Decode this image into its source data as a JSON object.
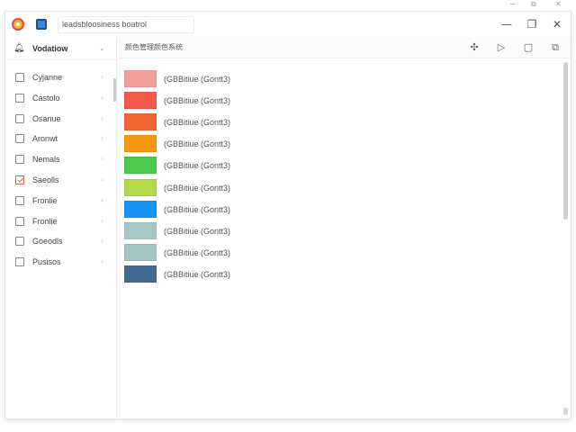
{
  "desktop": {
    "minimize": "−",
    "restore": "⧉",
    "close": "✕"
  },
  "titlebar": {
    "field_text": "leadsbloosiness boatrol",
    "minimize": "—",
    "maximize": "❐",
    "close": "✕"
  },
  "sidebar": {
    "header_label": "Vodatiow",
    "items": [
      {
        "label": "Cyjanne",
        "checked": false
      },
      {
        "label": "Castolo",
        "checked": false
      },
      {
        "label": "Osanue",
        "checked": false
      },
      {
        "label": "Aronwt",
        "checked": false
      },
      {
        "label": "Nemals",
        "checked": false
      },
      {
        "label": "Saeolls",
        "checked": true
      },
      {
        "label": "Fronlie",
        "checked": false
      },
      {
        "label": "Fronlie",
        "checked": false
      },
      {
        "label": "Goeodls",
        "checked": false
      },
      {
        "label": "Pusisos",
        "checked": false
      }
    ]
  },
  "main": {
    "title": "颜色管理颜色系统",
    "rows": [
      {
        "label": "(GBBitiue (Gontt3)",
        "color": "#f4a09a"
      },
      {
        "label": "(GBBitiue (Gontt3)",
        "color": "#f45a4c"
      },
      {
        "label": "(GBBitiue (Gontt3)",
        "color": "#f26535"
      },
      {
        "label": "(GBBitiue (Gontt3)",
        "color": "#f7960f"
      },
      {
        "label": "(GBBitiue (Gontt3)",
        "color": "#4ac94a"
      },
      {
        "label": "(GBBitiue (Gontt3)",
        "color": "#b5d94a"
      },
      {
        "label": "(GBBitiue (Gontt3)",
        "color": "#1794f5"
      },
      {
        "label": "(GBBitiue (Gontt3)",
        "color": "#a7c6c6"
      },
      {
        "label": "(GBBitiue (Gontt3)",
        "color": "#a4c4c4"
      },
      {
        "label": "(GBBitiue (Gontt3)",
        "color": "#436a90"
      }
    ]
  }
}
